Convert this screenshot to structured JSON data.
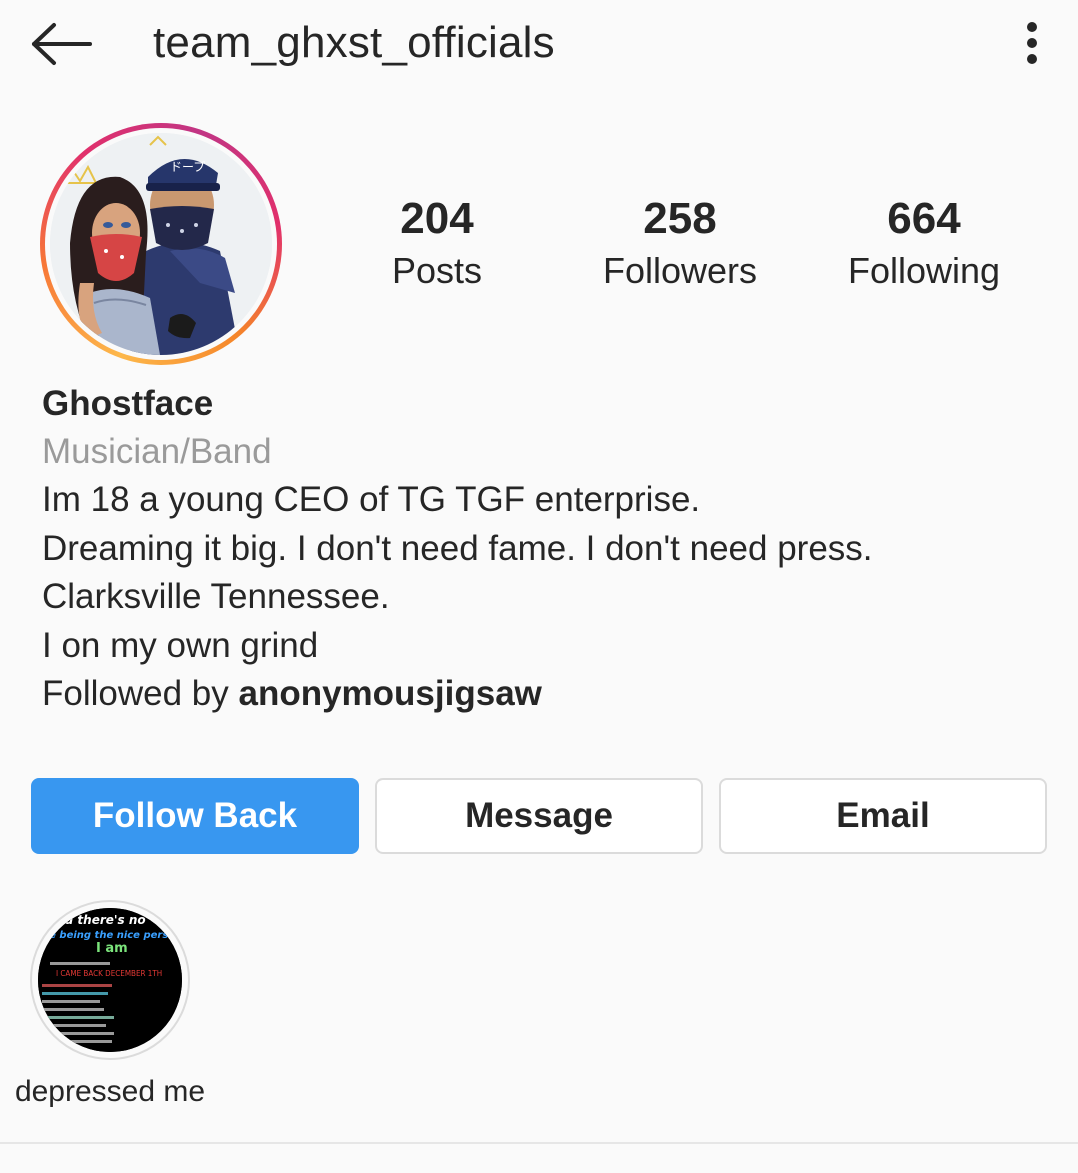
{
  "header": {
    "username": "team_ghxst_officials",
    "back_icon": "arrow-left-icon",
    "menu_icon": "vertical-dots-icon"
  },
  "profile": {
    "avatar_icon": "profile-picture",
    "stats": [
      {
        "value": "204",
        "label": "Posts"
      },
      {
        "value": "258",
        "label": "Followers"
      },
      {
        "value": "664",
        "label": "Following"
      }
    ]
  },
  "bio": {
    "name": "Ghostface",
    "category": "Musician/Band",
    "lines": [
      "Im 18 a young CEO of TG TGF enterprise.",
      "Dreaming it big. I don't need fame. I don't need press.",
      "Clarksville Tennessee.",
      "I on my own grind"
    ],
    "followed_by_prefix": "Followed by ",
    "followed_by_user": "anonymousjigsaw"
  },
  "actions": {
    "follow_back": "Follow Back",
    "message": "Message",
    "email": "Email"
  },
  "highlights": [
    {
      "label": "depressed me",
      "cover_text": {
        "line1": "and there's no",
        "line2": "be being the nice person",
        "line3": "I am",
        "line4": "I CAME BACK DECEMBER 1TH"
      }
    }
  ],
  "colors": {
    "follow_button": "#3897f0",
    "background": "#fafafa",
    "text_primary": "#262626",
    "text_secondary": "#9a9a9a",
    "border": "#dbdbdb"
  }
}
